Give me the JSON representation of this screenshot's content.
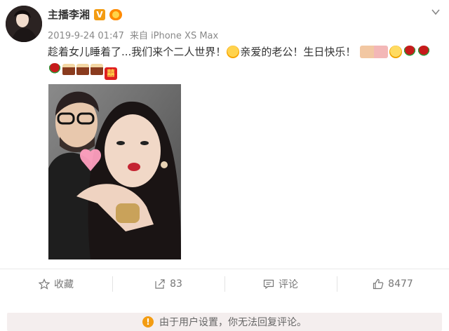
{
  "user": {
    "name": "主播李湘",
    "verified_badge": "V"
  },
  "meta": {
    "timestamp": "2019-9-24 01:47",
    "source_prefix": "来自",
    "source_device": "iPhone XS Max"
  },
  "post": {
    "line1_text_a": "趁着女儿睡着了...我们来个二人世界！",
    "line1_text_b": "亲爱的老公！生日快乐！",
    "xi_char": "囍"
  },
  "actions": {
    "favorite_label": "收藏",
    "repost_count": "83",
    "comment_label": "评论",
    "like_count": "8477"
  },
  "notice": {
    "text": "由于用户设置，你无法回复评论。",
    "icon": "!"
  },
  "colors": {
    "badge_orange": "#f39c12",
    "notice_bg": "#f4eeee"
  }
}
